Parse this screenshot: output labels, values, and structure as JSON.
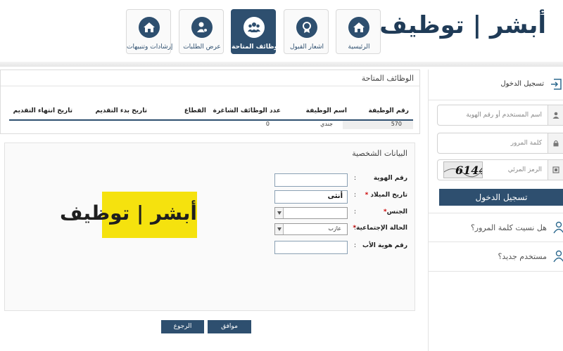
{
  "header": {
    "logo_text": "أبشر | توظيف",
    "nav": [
      {
        "label": "الرئيسية",
        "icon": "home-icon"
      },
      {
        "label": "اشعار القبول",
        "icon": "certificate-icon"
      },
      {
        "label": "الوظائف المتاحة",
        "icon": "team-icon",
        "active": true
      },
      {
        "label": "عرض الطلبات",
        "icon": "user-settings-icon"
      },
      {
        "label": "إرشادات وتنبيهات",
        "icon": "home-icon"
      }
    ]
  },
  "login": {
    "title": "تسجيل الدخول",
    "username_placeholder": "اسم المستخدم أو رقم الهوية",
    "password_placeholder": "كلمة المرور",
    "captcha_placeholder": "الرمز المرئي",
    "captcha_text": "6144",
    "submit_label": "تسجيل الدخول",
    "forgot_password": "هل نسيت كلمة المرور؟",
    "new_user": "مستخدم جديد؟"
  },
  "jobs": {
    "title": "الوظائف المتاحة",
    "columns": [
      "رقم الوظيفة",
      "اسم الوظيفة",
      "عدد الوظائف الشاغرة",
      "القطاع",
      "تاريخ بدء التقديم",
      "تاريخ انتهاء التقديم"
    ],
    "rows": [
      {
        "number": "570",
        "name": "جندي",
        "vacancies": "0"
      }
    ]
  },
  "personal": {
    "title": "البيانات الشخصية",
    "fields": {
      "id_label": "رقم الهوية",
      "dob_label": "تاريخ الميلاد",
      "dob_value": "أنثى",
      "gender_label": "الجنس",
      "marital_label": "الحالة الإجتماعية",
      "marital_value": "عازب",
      "father_id_label": "رقم هوية الأب"
    },
    "promo_text": "أبشر | توظيف"
  },
  "actions": {
    "ok_label": "موافق",
    "back_label": "الرجوع"
  },
  "colors": {
    "primary": "#2e4f6f",
    "promo_bg": "#f5e20e"
  }
}
